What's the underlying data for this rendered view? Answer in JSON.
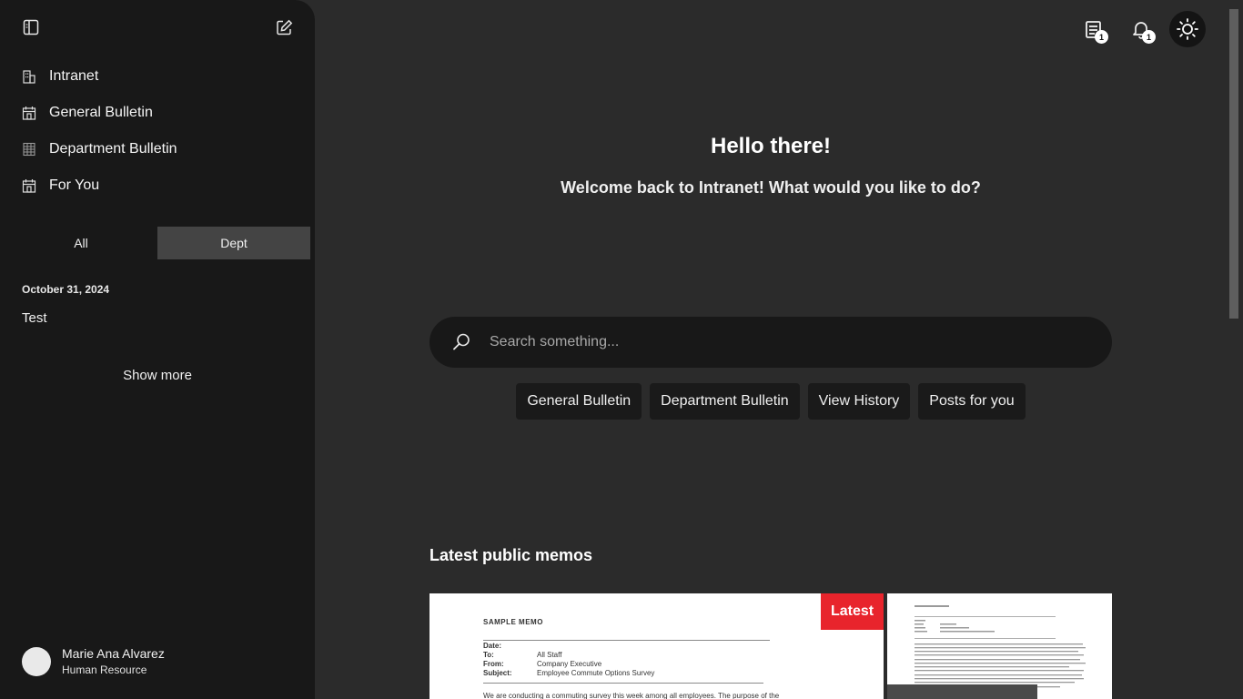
{
  "sidebar": {
    "nav": [
      {
        "label": "Intranet",
        "icon": "building-icon"
      },
      {
        "label": "General Bulletin",
        "icon": "calendar-building-icon"
      },
      {
        "label": "Department Bulletin",
        "icon": "grid-building-icon"
      },
      {
        "label": "For You",
        "icon": "calendar-building-icon"
      }
    ],
    "toggle": {
      "all": "All",
      "dept": "Dept",
      "active": "Dept"
    },
    "recent": {
      "date": "October 31, 2024",
      "items": [
        "Test"
      ]
    },
    "show_more": "Show more",
    "user": {
      "name": "Marie Ana Alvarez",
      "department": "Human Resource"
    }
  },
  "topbar": {
    "memo_count": "1",
    "notification_count": "1"
  },
  "hero": {
    "title": "Hello there!",
    "subtitle": "Welcome back to Intranet! What would you like to do?"
  },
  "search": {
    "placeholder": "Search something..."
  },
  "chips": [
    "General Bulletin",
    "Department Bulletin",
    "View History",
    "Posts for you"
  ],
  "memos": {
    "section_title": "Latest public memos",
    "latest_badge": "Latest",
    "card1": {
      "heading": "SAMPLE MEMO",
      "rows": [
        {
          "k": "Date:",
          "v": ""
        },
        {
          "k": "To:",
          "v": "All Staff"
        },
        {
          "k": "From:",
          "v": "Company Executive"
        },
        {
          "k": "Subject:",
          "v": "Employee Commute Options Survey"
        }
      ],
      "body": "We are conducting a commuting survey this week among all employees.  The purpose of the"
    }
  },
  "colors": {
    "accent": "#e8242c",
    "sidebar_bg": "#181818",
    "main_bg": "#2b2b2b"
  }
}
